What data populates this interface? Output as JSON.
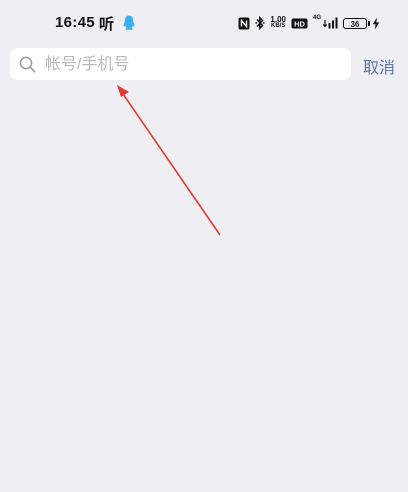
{
  "status_bar": {
    "time": "16:45",
    "app_indicator": "听",
    "network_speed_value": "1.00",
    "network_speed_unit": "KB/S",
    "hd_label": "HD",
    "network_type": "4G",
    "battery_level": "36",
    "icons": [
      "qq-icon",
      "nfc-icon",
      "bluetooth-icon",
      "hd-icon",
      "signal-icon",
      "charging-icon"
    ]
  },
  "search": {
    "placeholder": "帐号/手机号",
    "value": "",
    "cancel_label": "取消"
  },
  "annotation": {
    "type": "arrow",
    "color": "#e53935",
    "points_to": "search-input"
  },
  "colors": {
    "background": "#efeff3",
    "search_box": "#ffffff",
    "cancel_text": "#5876a8",
    "qq_icon": "#3bb0f0"
  }
}
